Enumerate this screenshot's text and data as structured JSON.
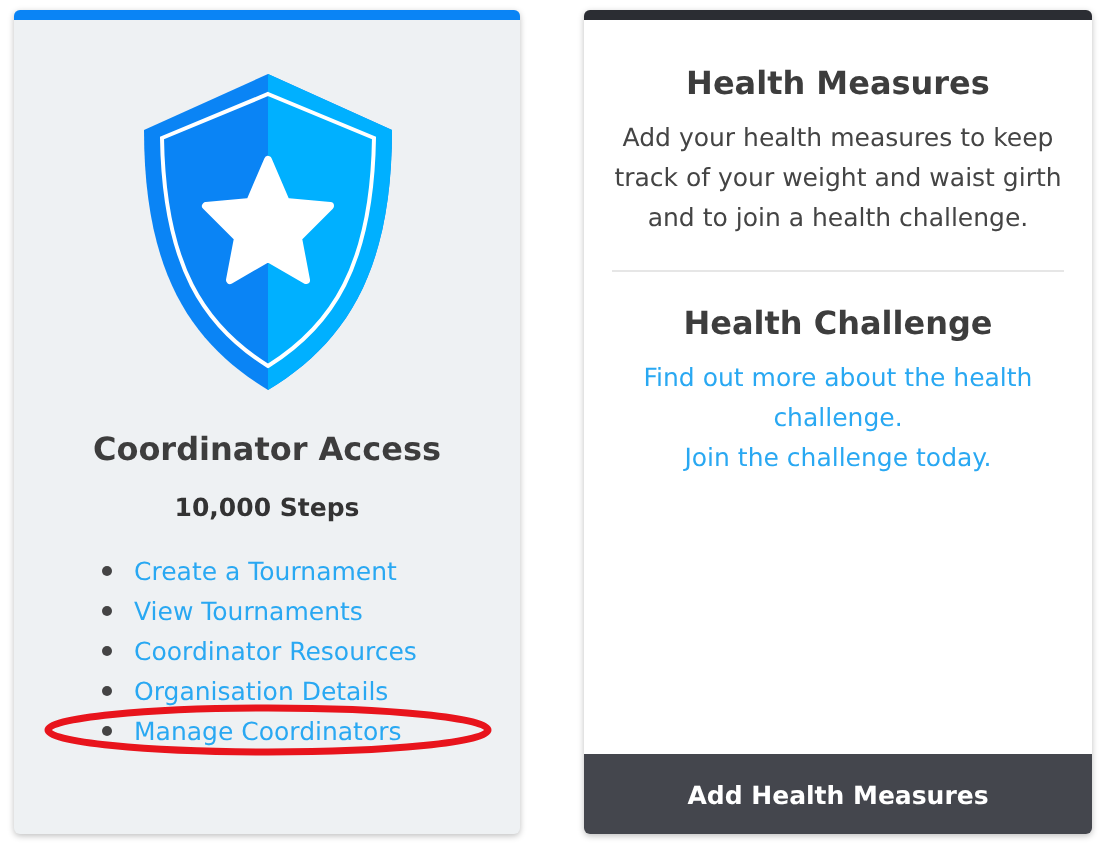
{
  "coordinator_card": {
    "title": "Coordinator Access",
    "subtitle": "10,000 Steps",
    "links": [
      {
        "label": "Create a Tournament",
        "highlighted": false
      },
      {
        "label": "View Tournaments",
        "highlighted": false
      },
      {
        "label": "Coordinator Resources",
        "highlighted": false
      },
      {
        "label": "Organisation Details",
        "highlighted": false
      },
      {
        "label": "Manage Coordinators",
        "highlighted": true
      }
    ]
  },
  "health_card": {
    "sections": [
      {
        "title": "Health Measures",
        "text": "Add your health measures to keep track of your weight and waist girth and to join a health challenge."
      },
      {
        "title": "Health Challenge",
        "links": [
          "Find out more about the health challenge.",
          "Join the challenge today."
        ]
      }
    ],
    "button": "Add Health Measures"
  }
}
